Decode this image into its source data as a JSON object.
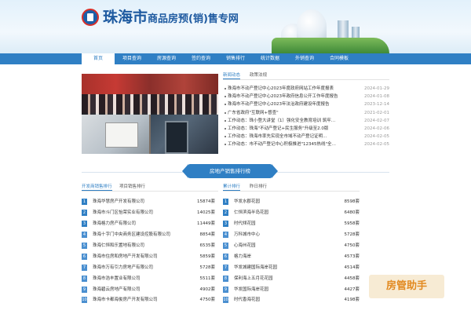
{
  "header": {
    "title_city": "珠海市",
    "title_rest": "商品房预(销)售专网"
  },
  "nav": {
    "items": [
      {
        "label": "首页",
        "active": true
      },
      {
        "label": "项目查询"
      },
      {
        "label": "房源查询"
      },
      {
        "label": "签约查询"
      },
      {
        "label": "销售排行"
      },
      {
        "label": "统计数据"
      },
      {
        "label": "外销查询"
      },
      {
        "label": "合同模板"
      }
    ]
  },
  "news": {
    "tabs": [
      {
        "label": "新闻动态",
        "active": true
      },
      {
        "label": "政策法规"
      }
    ],
    "items": [
      {
        "title": "珠海市不动产登记中心2023年度政府网站工作年度报表",
        "date": "2024-01-29"
      },
      {
        "title": "珠海市不动产登记中心2023年政府信息公开工作年度报告",
        "date": "2024-01-08"
      },
      {
        "title": "珠海市不动产登记中心2023年法治政府建设年度报告",
        "date": "2023-12-14"
      },
      {
        "title": "广东省政府\"互联网+督查\"",
        "date": "2021-02-01"
      },
      {
        "title": "工作动态：珠小登大讲堂（1）强化安全教育培训 筑牢…",
        "date": "2024-02-07"
      },
      {
        "title": "工作动态：珠海\"不动产登记+民生服务\"升级至2.0版",
        "date": "2024-02-06"
      },
      {
        "title": "工作动态：珠海市率先实现全市域不动产登记证明…",
        "date": "2024-02-05"
      },
      {
        "title": "工作动态：市不动产登记中心积极推进\"12345热线\"全…",
        "date": "2024-02-05"
      }
    ]
  },
  "ranking": {
    "banner": "房地产销售排行榜",
    "developers": {
      "tabs": [
        {
          "label": "开发商销售排行",
          "active": true
        },
        {
          "label": "项目销售排行"
        }
      ],
      "items": [
        {
          "rank": "1",
          "name": "珠海华慧房产开发有限公司",
          "value": "15874套"
        },
        {
          "rank": "2",
          "name": "珠海市斗门区怡荣实业有限公司",
          "value": "14025套"
        },
        {
          "rank": "3",
          "name": "珠海格力房产有限公司",
          "value": "11449套"
        },
        {
          "rank": "4",
          "name": "珠海十字门中央商务区建设控股有限公司",
          "value": "8854套"
        },
        {
          "rank": "5",
          "name": "珠海仁恒和乐置地有限公司",
          "value": "6535套"
        },
        {
          "rank": "6",
          "name": "珠海市住房和房地产开发有限公司",
          "value": "5859套"
        },
        {
          "rank": "7",
          "name": "珠海市万有引力房地产有限公司",
          "value": "5728套"
        },
        {
          "rank": "8",
          "name": "珠海市浩丰置业有限公司",
          "value": "5511套"
        },
        {
          "rank": "9",
          "name": "珠海碧云房地产有限公司",
          "value": "4902套"
        },
        {
          "rank": "10",
          "name": "珠海市卡都海俊房产开发有限公司",
          "value": "4750套"
        }
      ]
    },
    "projects": {
      "tabs": [
        {
          "label": "累计排行",
          "active": true
        },
        {
          "label": "昨日排行"
        }
      ],
      "items": [
        {
          "rank": "1",
          "name": "华发水郡花园",
          "value": "8598套"
        },
        {
          "rank": "2",
          "name": "仁恒滨海半岛花园",
          "value": "6480套"
        },
        {
          "rank": "3",
          "name": "时代倾花园",
          "value": "5958套"
        },
        {
          "rank": "4",
          "name": "万科城市中心",
          "value": "5728套"
        },
        {
          "rank": "5",
          "name": "心海州花园",
          "value": "4750套"
        },
        {
          "rank": "6",
          "name": "格力海岸",
          "value": "4573套"
        },
        {
          "rank": "7",
          "name": "华发城建国际海岸花园",
          "value": "4514套"
        },
        {
          "rank": "8",
          "name": "保利海上五月花花园",
          "value": "4458套"
        },
        {
          "rank": "9",
          "name": "华发国际海岸花园",
          "value": "4427套"
        },
        {
          "rank": "10",
          "name": "时代香海花园",
          "value": "4198套"
        }
      ]
    }
  },
  "watermark": "房管助手"
}
